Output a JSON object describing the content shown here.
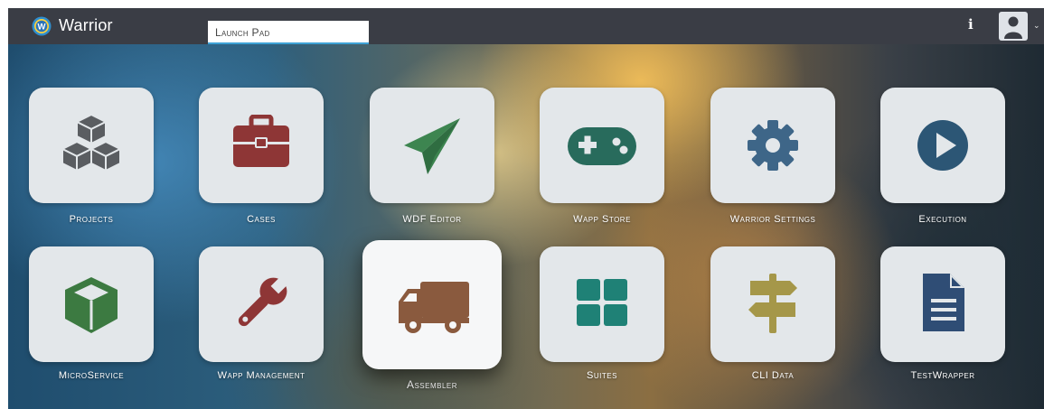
{
  "header": {
    "app_title": "Warrior",
    "logo_letter": "W",
    "breadcrumb": "Launch Pad",
    "info_label": "i",
    "user_menu_caret": "⌄"
  },
  "colors": {
    "topbar": "#3a3d45",
    "tile": "#e3e7ea",
    "accent_underline": "#3ea2d6"
  },
  "apps": [
    {
      "label": "Projects",
      "icon": "cubes-icon",
      "color": "#5a5d61"
    },
    {
      "label": "Cases",
      "icon": "briefcase-icon",
      "color": "#8e3636"
    },
    {
      "label": "WDF Editor",
      "icon": "paper-plane-icon",
      "color": "#3d8550"
    },
    {
      "label": "Wapp Store",
      "icon": "gamepad-icon",
      "color": "#286b5c"
    },
    {
      "label": "Warrior Settings",
      "icon": "gear-icon",
      "color": "#3e6688"
    },
    {
      "label": "Execution",
      "icon": "play-circle-icon",
      "color": "#2c5675"
    },
    {
      "label": "MicroService",
      "icon": "cube-icon",
      "color": "#3c7a41"
    },
    {
      "label": "Wapp Management",
      "icon": "wrench-icon",
      "color": "#8e3636"
    },
    {
      "label": "Assembler",
      "icon": "truck-icon",
      "color": "#8a5a3e"
    },
    {
      "label": "Suites",
      "icon": "grid-icon",
      "color": "#1f8176"
    },
    {
      "label": "CLI Data",
      "icon": "signpost-icon",
      "color": "#a59749"
    },
    {
      "label": "TestWrapper",
      "icon": "document-icon",
      "color": "#2f4d75"
    }
  ]
}
